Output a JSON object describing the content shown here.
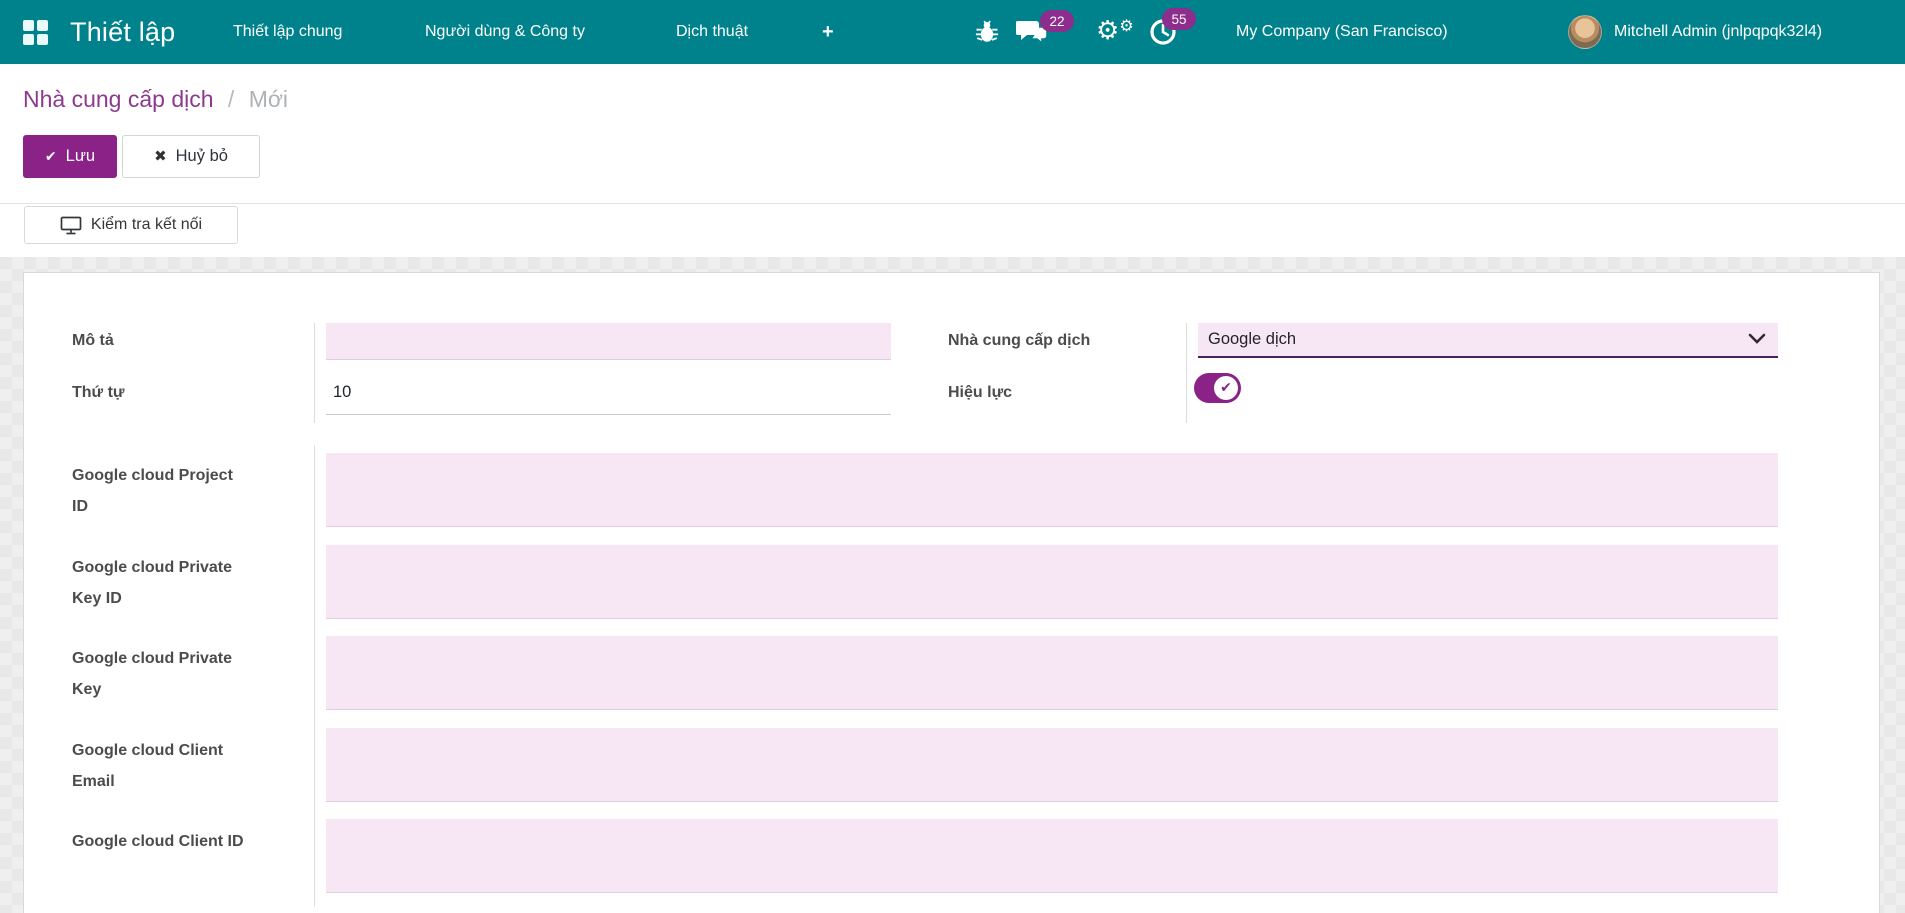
{
  "navbar": {
    "app_title": "Thiết lập",
    "menus": [
      {
        "label": "Thiết lập chung"
      },
      {
        "label": "Người dùng & Công ty"
      },
      {
        "label": "Dịch thuật"
      },
      {
        "label": "+"
      }
    ],
    "systray": {
      "messages_count": "22",
      "activities_count": "55",
      "company": "My Company (San Francisco)",
      "user": "Mitchell Admin (jnlpqpqk32l4)"
    },
    "colors": {
      "bg": "#00828C",
      "badge": "#8D2D8D"
    }
  },
  "breadcrumb": {
    "parent": "Nhà cung cấp dịch",
    "separator": "/",
    "current": "Mới"
  },
  "actions": {
    "save": "Lưu",
    "save_icon": "✔",
    "discard": "Huỷ bỏ",
    "discard_icon": "✖",
    "test_connection": "Kiểm tra kết nối"
  },
  "form": {
    "fields": {
      "description": {
        "label": "Mô tả",
        "value": "",
        "placeholder": ""
      },
      "provider": {
        "label": "Nhà cung cấp dịch",
        "value": "Google dịch"
      },
      "sequence": {
        "label": "Thứ tự",
        "value": "10"
      },
      "active": {
        "label": "Hiệu lực",
        "checked": "✔"
      },
      "google_rows": [
        {
          "label": "Google cloud Project ID",
          "value": ""
        },
        {
          "label": "Google cloud Private Key ID",
          "value": ""
        },
        {
          "label": "Google cloud Private Key",
          "value": ""
        },
        {
          "label": "Google cloud Client Email",
          "value": ""
        },
        {
          "label": "Google cloud Client ID",
          "value": ""
        }
      ]
    },
    "colors": {
      "required_field_bg": "#F7E7F4",
      "primary": "#8A2288",
      "breadcrumb_link": "#8D3A8D",
      "select_border": "#4A215A"
    }
  }
}
